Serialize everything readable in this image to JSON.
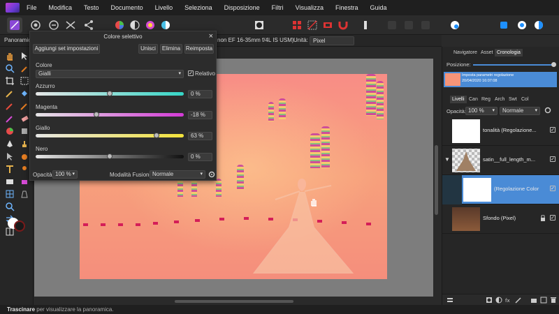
{
  "menubar": {
    "items": [
      "File",
      "Modifica",
      "Testo",
      "Documento",
      "Livello",
      "Seleziona",
      "Disposizione",
      "Filtri",
      "Visualizza",
      "Finestra",
      "Guida"
    ]
  },
  "context": {
    "tool_name": "Panoramica",
    "lens_text": "non EF 16-35mm f/4L IS USM)",
    "unit_label": "Unità:",
    "unit_value": "Pixel"
  },
  "dialog": {
    "title": "Colore selettivo",
    "close": "×",
    "buttons": {
      "add_preset": "Aggiungi set impostazioni",
      "merge": "Unisci",
      "delete": "Elimina",
      "reset": "Reimposta"
    },
    "color_label": "Colore",
    "color_value": "Gialli",
    "relative_label": "Relativo",
    "relative_checked": "✓",
    "sliders": [
      {
        "label": "Azzurro",
        "value": "0 %"
      },
      {
        "label": "Magenta",
        "value": "-18 %"
      },
      {
        "label": "Giallo",
        "value": "63 %"
      },
      {
        "label": "Nero",
        "value": "0 %"
      }
    ],
    "slider_levels": [
      0.5,
      0.41,
      0.815,
      0.5
    ],
    "opacity_label": "Opacità:",
    "opacity_value": "100 %",
    "blend_label": "Modalità Fusione:",
    "blend_value": "Normale"
  },
  "right_panel": {
    "top_tabs": [
      "Navigatore",
      "Asset",
      "Cronologia"
    ],
    "position_label": "Posizione:",
    "history": {
      "line1": "Imposta parametri regolazione",
      "line2": "20/04/2020 16:07:08"
    },
    "layer_tabs": [
      "Livelli",
      "Can",
      "Reg",
      "Arch",
      "Swt",
      "Col"
    ],
    "opacity_label": "Opacità:",
    "opacity_value": "100 %",
    "blend_value": "Normale",
    "layers": [
      {
        "name": "tonalità (Regolazione...",
        "check": "✓"
      },
      {
        "name": "satin__full_length_m...",
        "check": "✓"
      },
      {
        "name": "(Regolazione Color",
        "check": "✓"
      },
      {
        "name": "Sfondo (Pixel)",
        "check": "✓"
      }
    ]
  },
  "status": {
    "bold": "Trascinare",
    "rest": " per visualizzare la panoramica."
  },
  "colors": {
    "accent": "#4a8bd6",
    "canvas_pink": "#f88d86",
    "workspace": "#7d7d7d"
  }
}
